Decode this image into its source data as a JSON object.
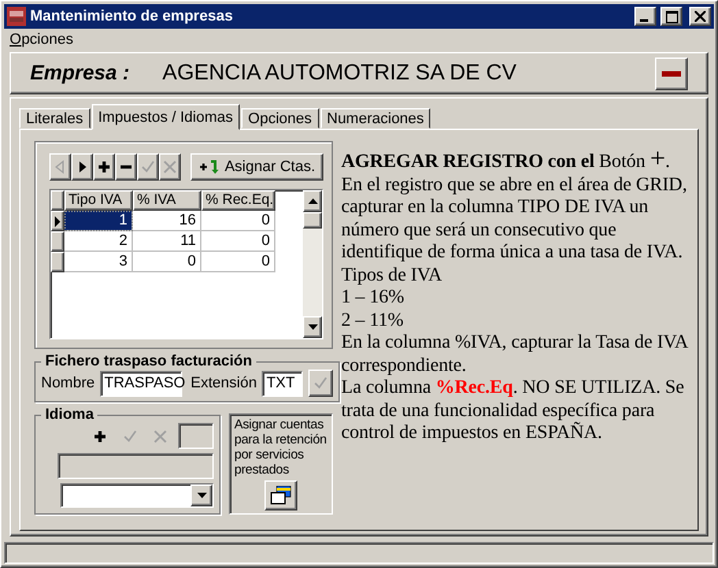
{
  "window": {
    "title": "Mantenimiento de empresas"
  },
  "menu": [
    {
      "label": "Opciones"
    }
  ],
  "header": {
    "label": "Empresa :",
    "value": "AGENCIA AUTOMOTRIZ SA DE CV"
  },
  "tabs": [
    {
      "label": "Literales",
      "selected": false
    },
    {
      "label": "Impuestos / Idiomas",
      "selected": true
    },
    {
      "label": "Opciones",
      "selected": false
    },
    {
      "label": "Numeraciones",
      "selected": false
    }
  ],
  "toolbar": [
    {
      "kind": "prev",
      "disabled": true
    },
    {
      "kind": "next",
      "disabled": false
    },
    {
      "kind": "add",
      "disabled": false
    },
    {
      "kind": "remove",
      "disabled": false
    },
    {
      "kind": "accept",
      "disabled": true
    },
    {
      "kind": "cancel",
      "disabled": true
    }
  ],
  "assign_button": "Asignar Ctas.",
  "grid": {
    "columns": [
      "Tipo IVA",
      "% IVA",
      "% Rec.Eq."
    ],
    "rows": [
      {
        "cells": [
          "1",
          "16",
          "0"
        ],
        "selected": true
      },
      {
        "cells": [
          "2",
          "11",
          "0"
        ],
        "selected": false
      },
      {
        "cells": [
          "3",
          "0",
          "0"
        ],
        "selected": false
      }
    ]
  },
  "transfer": {
    "title": "Fichero traspaso facturación",
    "name_label": "Nombre",
    "name_value": "TRASPASO",
    "ext_label": "Extensión",
    "ext_value": "TXT"
  },
  "language": {
    "title": "Idioma",
    "tools": [
      {
        "kind": "add",
        "disabled": false
      },
      {
        "kind": "accept",
        "disabled": true
      },
      {
        "kind": "cancel",
        "disabled": true
      }
    ]
  },
  "retention": {
    "label": "Asignar cuentas para la retención por servicios prestados"
  },
  "notes": [
    [
      {
        "text": "AGREGAR REGISTRO con el",
        "kind": "bold"
      },
      {
        "text": " Botón ",
        "kind": "plain"
      },
      {
        "text": "+",
        "kind": "big"
      },
      {
        "text": ".",
        "kind": "plain"
      }
    ],
    [
      {
        "text": "En el registro que se abre en el área de GRID, capturar en la columna TIPO DE IVA un número que será un consecutivo que identifique de forma única a una tasa de IVA.",
        "kind": "plain"
      }
    ],
    [
      {
        "text": "Tipos de IVA",
        "kind": "plain"
      }
    ],
    [
      {
        "text": "1 – 16%",
        "kind": "plain"
      }
    ],
    [
      {
        "text": "2 – 11%",
        "kind": "plain"
      }
    ],
    [
      {
        "text": "En la columna %IVA, capturar la Tasa de IVA correspondiente.",
        "kind": "plain"
      }
    ],
    [
      {
        "text": "La columna ",
        "kind": "plain"
      },
      {
        "text": "%Rec.Eq",
        "kind": "alert"
      },
      {
        "text": ". NO SE UTILIZA. Se trata de una funcionalidad específica para control de impuestos en ESPAÑA.",
        "kind": "plain"
      }
    ]
  ]
}
